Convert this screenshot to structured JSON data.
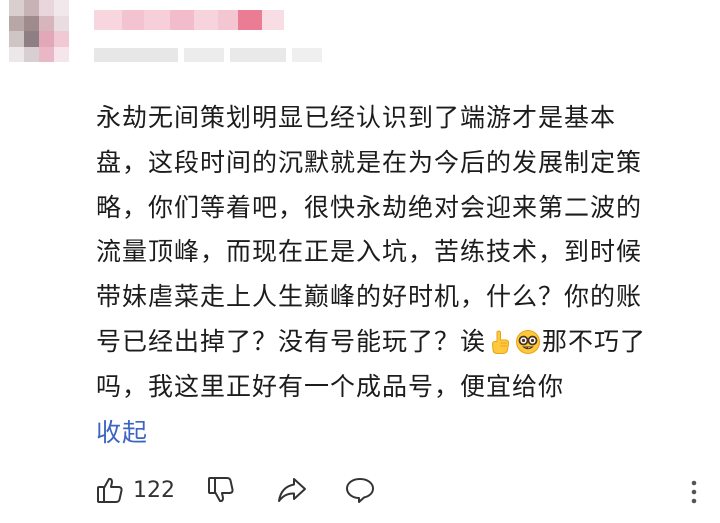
{
  "comment": {
    "lines": [
      "永劫无间策划明显已经认识到了端游才是基本",
      "盘，这段时间的沉默就是在为今后的发展制定策",
      "略，你们等着吧，很快永劫绝对会迎来第二波的",
      "流量顶峰，而现在正是入坑，苦练技术，到时候",
      "带妹虐菜走上人生巅峰的好时机，什么？你的账",
      "号已经出掉了？没有号能玩了？诶",
      "那不巧了",
      "吗，我这里正好有一个成品号，便宜给你"
    ],
    "emojis": [
      "point-up-emoji",
      "nerd-face-emoji"
    ]
  },
  "collapse_label": "收起",
  "actions": {
    "like_count": "122",
    "icons": [
      "thumbs-up-icon",
      "thumbs-down-icon",
      "share-icon",
      "reply-icon",
      "more-vertical-icon"
    ]
  },
  "colors": {
    "link": "#3d64c2",
    "text": "#1c1c1c",
    "icon": "#333333"
  }
}
